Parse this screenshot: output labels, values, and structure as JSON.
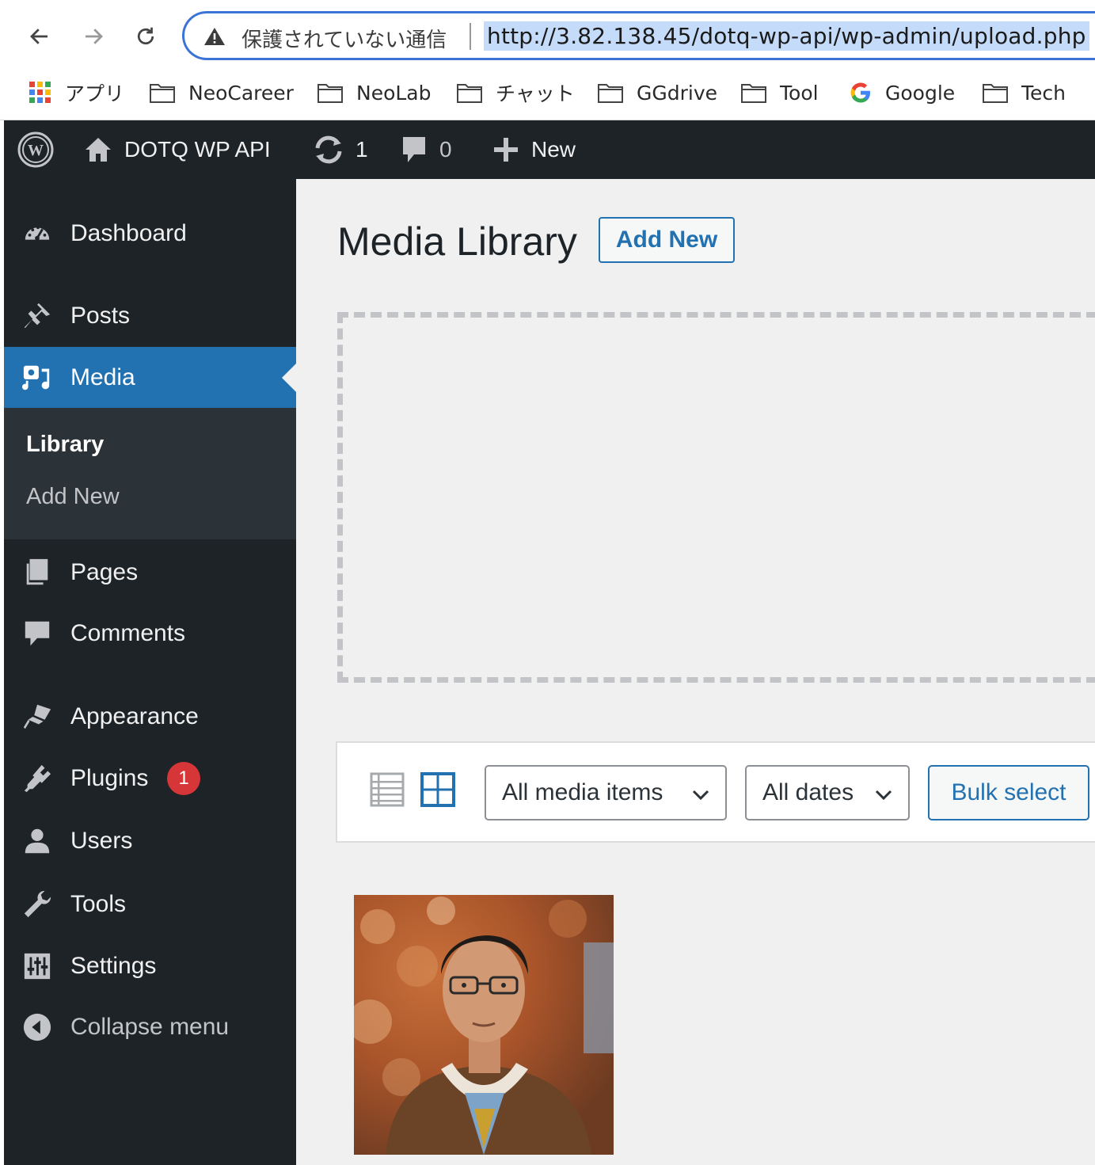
{
  "browser": {
    "security_label": "保護されていない通信",
    "url": "http://3.82.138.45/dotq-wp-api/wp-admin/upload.php",
    "bookmarks": [
      {
        "label": "アプリ",
        "icon": "apps-grid-icon"
      },
      {
        "label": "NeoCareer",
        "icon": "folder-icon"
      },
      {
        "label": "NeoLab",
        "icon": "folder-icon"
      },
      {
        "label": "チャット",
        "icon": "folder-icon"
      },
      {
        "label": "GGdrive",
        "icon": "folder-icon"
      },
      {
        "label": "Tool",
        "icon": "folder-icon"
      },
      {
        "label": "Google",
        "icon": "google-icon"
      },
      {
        "label": "Tech",
        "icon": "folder-icon"
      }
    ]
  },
  "adminbar": {
    "site_name": "DOTQ WP API",
    "updates_count": "1",
    "comments_count": "0",
    "new_label": "New"
  },
  "sidebar": {
    "items": [
      {
        "label": "Dashboard",
        "icon": "dashboard-icon"
      },
      {
        "label": "Posts",
        "icon": "pin-icon"
      },
      {
        "label": "Media",
        "icon": "media-icon"
      },
      {
        "label": "Pages",
        "icon": "pages-icon"
      },
      {
        "label": "Comments",
        "icon": "comment-icon"
      },
      {
        "label": "Appearance",
        "icon": "brush-icon"
      },
      {
        "label": "Plugins",
        "icon": "plugin-icon"
      },
      {
        "label": "Users",
        "icon": "user-icon"
      },
      {
        "label": "Tools",
        "icon": "wrench-icon"
      },
      {
        "label": "Settings",
        "icon": "settings-icon"
      },
      {
        "label": "Collapse menu",
        "icon": "collapse-icon"
      }
    ],
    "media_submenu": [
      "Library",
      "Add New"
    ],
    "plugins_badge": "1"
  },
  "main": {
    "title": "Media Library",
    "add_new_label": "Add New",
    "filter_type": "All media items",
    "filter_date": "All dates",
    "bulk_select_label": "Bulk select"
  },
  "colors": {
    "admin_dark": "#1d2327",
    "accent_blue": "#2271b1",
    "badge_red": "#d63638",
    "content_bg": "#f0f0f1"
  }
}
